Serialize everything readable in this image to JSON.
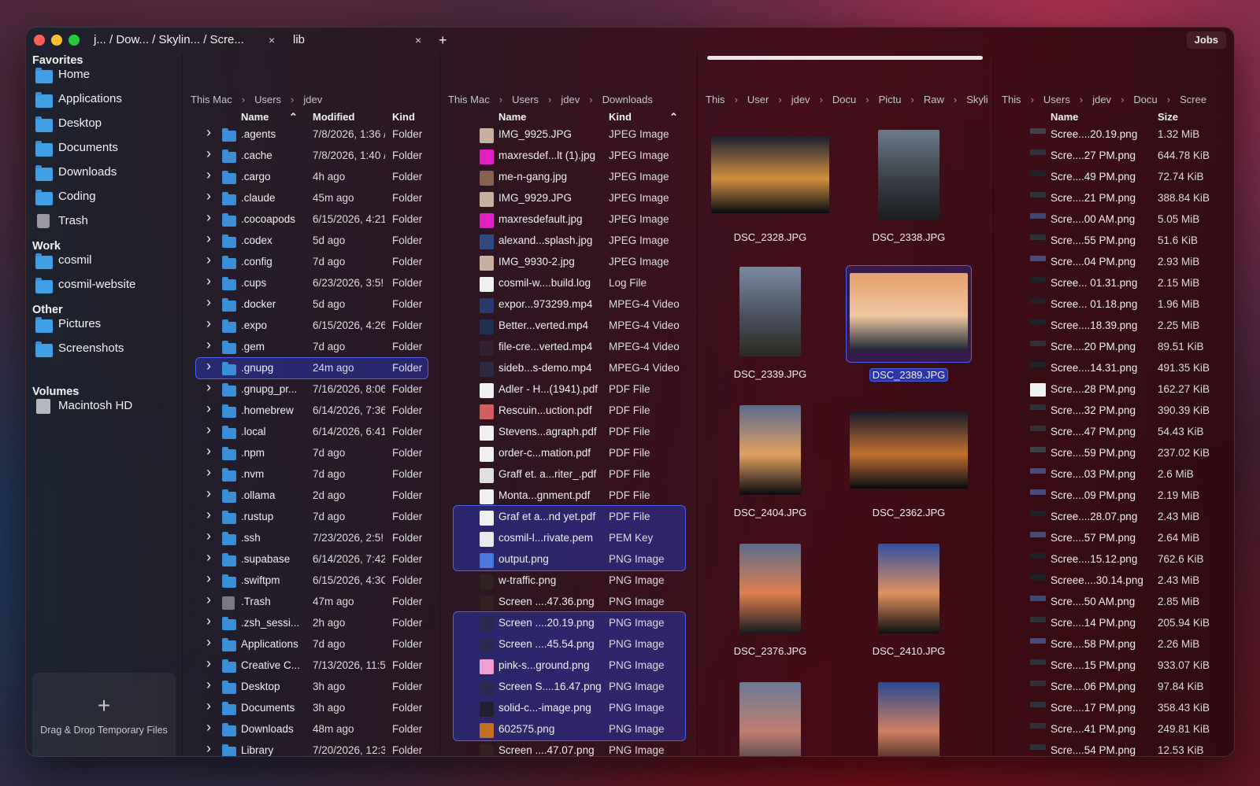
{
  "tabs": [
    {
      "label": "j... / Dow... / Skylin... / Scre...",
      "close": "×"
    },
    {
      "label": "lib",
      "close": "×"
    }
  ],
  "new_tab": "+",
  "jobs_label": "Jobs",
  "sidebar": {
    "sections": [
      {
        "title": "Favorites",
        "items": [
          "Home",
          "Applications",
          "Desktop",
          "Documents",
          "Downloads",
          "Coding",
          "Trash"
        ]
      },
      {
        "title": "Work",
        "items": [
          "cosmil",
          "cosmil-website"
        ]
      },
      {
        "title": "Other",
        "items": [
          "Pictures",
          "Screenshots"
        ]
      },
      {
        "title": "Volumes",
        "items": [
          "Macintosh HD"
        ]
      }
    ],
    "dropzone_plus": "+",
    "dropzone_label": "Drag & Drop Temporary Files"
  },
  "pane1": {
    "breadcrumb": [
      "This Mac",
      "Users",
      "jdev"
    ],
    "columns": [
      "Name",
      "Modified",
      "Kind"
    ],
    "rows": [
      [
        ".agents",
        "7/8/2026, 1:36 /",
        "Folder"
      ],
      [
        ".cache",
        "7/8/2026, 1:40 /",
        "Folder"
      ],
      [
        ".cargo",
        "4h ago",
        "Folder"
      ],
      [
        ".claude",
        "45m ago",
        "Folder"
      ],
      [
        ".cocoapods",
        "6/15/2026, 4:21",
        "Folder"
      ],
      [
        ".codex",
        "5d ago",
        "Folder"
      ],
      [
        ".config",
        "7d ago",
        "Folder"
      ],
      [
        ".cups",
        "6/23/2026, 3:5!",
        "Folder"
      ],
      [
        ".docker",
        "5d ago",
        "Folder"
      ],
      [
        ".expo",
        "6/15/2026, 4:26",
        "Folder"
      ],
      [
        ".gem",
        "7d ago",
        "Folder"
      ],
      [
        ".gnupg",
        "24m ago",
        "Folder"
      ],
      [
        ".gnupg_pr...",
        "7/16/2026, 8:06",
        "Folder"
      ],
      [
        ".homebrew",
        "6/14/2026, 7:36",
        "Folder"
      ],
      [
        ".local",
        "6/14/2026, 6:41",
        "Folder"
      ],
      [
        ".npm",
        "7d ago",
        "Folder"
      ],
      [
        ".nvm",
        "7d ago",
        "Folder"
      ],
      [
        ".ollama",
        "2d ago",
        "Folder"
      ],
      [
        ".rustup",
        "7d ago",
        "Folder"
      ],
      [
        ".ssh",
        "7/23/2026, 2:5!",
        "Folder"
      ],
      [
        ".supabase",
        "6/14/2026, 7:42",
        "Folder"
      ],
      [
        ".swiftpm",
        "6/15/2026, 4:3C",
        "Folder"
      ],
      [
        ".Trash",
        "47m ago",
        "Folder"
      ],
      [
        ".zsh_sessi...",
        "2h ago",
        "Folder"
      ],
      [
        "Applications",
        "7d ago",
        "Folder"
      ],
      [
        "Creative C...",
        "7/13/2026, 11:5€",
        "Folder"
      ],
      [
        "Desktop",
        "3h ago",
        "Folder"
      ],
      [
        "Documents",
        "3h ago",
        "Folder"
      ],
      [
        "Downloads",
        "48m ago",
        "Folder"
      ],
      [
        "Library",
        "7/20/2026, 12:3",
        "Folder"
      ]
    ]
  },
  "pane2": {
    "breadcrumb": [
      "This Mac",
      "Users",
      "jdev",
      "Downloads"
    ],
    "columns": [
      "Name",
      "Kind"
    ],
    "rows": [
      [
        "IMG_9925.JPG",
        "JPEG Image",
        "#c8b0a0"
      ],
      [
        "maxresdef...lt (1).jpg",
        "JPEG Image",
        "#e020c0"
      ],
      [
        "me-n-gang.jpg",
        "JPEG Image",
        "#8a6050"
      ],
      [
        "IMG_9929.JPG",
        "JPEG Image",
        "#c8b0a0"
      ],
      [
        "maxresdefault.jpg",
        "JPEG Image",
        "#e020c0"
      ],
      [
        "alexand...splash.jpg",
        "JPEG Image",
        "#304a80"
      ],
      [
        "IMG_9930-2.jpg",
        "JPEG Image",
        "#c8b0a0"
      ],
      [
        "cosmil-w....build.log",
        "Log File",
        "#f0f0f0"
      ],
      [
        "expor...973299.mp4",
        "MPEG-4 Video",
        "#2a3a70"
      ],
      [
        "Better...verted.mp4",
        "MPEG-4 Video",
        "#203050"
      ],
      [
        "file-cre...verted.mp4",
        "MPEG-4 Video",
        "#302030"
      ],
      [
        "sideb...s-demo.mp4",
        "MPEG-4 Video",
        "#302840"
      ],
      [
        "Adler - H...(1941).pdf",
        "PDF File",
        "#f0f0f0"
      ],
      [
        "Rescuin...uction.pdf",
        "PDF File",
        "#d06060"
      ],
      [
        "Stevens...agraph.pdf",
        "PDF File",
        "#f0f0f0"
      ],
      [
        "order-c...mation.pdf",
        "PDF File",
        "#f0f0f0"
      ],
      [
        "Graff et. a...riter_.pdf",
        "PDF File",
        "#e0e0e0"
      ],
      [
        "Monta...gnment.pdf",
        "PDF File",
        "#f0f0f0"
      ],
      [
        "Graf et a...nd yet.pdf",
        "PDF File",
        "#f0f0f0"
      ],
      [
        "cosmil-l...rivate.pem",
        "PEM Key",
        "#e8e8ee"
      ],
      [
        "output.png",
        "PNG Image",
        "#4a7ae0"
      ],
      [
        "w-traffic.png",
        "PNG Image",
        "#302020"
      ],
      [
        "Screen ....47.36.png",
        "PNG Image",
        "#302020"
      ],
      [
        "Screen ....20.19.png",
        "PNG Image",
        "#2a2a50"
      ],
      [
        "Screen ....45.54.png",
        "PNG Image",
        "#2a2a50"
      ],
      [
        "pink-s...ground.png",
        "PNG Image",
        "#f0a0d0"
      ],
      [
        "Screen S....16.47.png",
        "PNG Image",
        "#2a2a50"
      ],
      [
        "solid-c...-image.png",
        "PNG Image",
        "#202030"
      ],
      [
        "602575.png",
        "PNG Image",
        "#c07020"
      ],
      [
        "Screen ....47.07.png",
        "PNG Image",
        "#302020"
      ]
    ]
  },
  "pane3": {
    "breadcrumb": [
      "This",
      "User",
      "jdev",
      "Docu",
      "Pictu",
      "Raw",
      "Skyli"
    ],
    "thumbnails": [
      {
        "label": "DSC_2328.JPG",
        "orientation": "landscape",
        "colors": [
          "#1a1f2e",
          "#d09040",
          "#0a0a10"
        ]
      },
      {
        "label": "DSC_2338.JPG",
        "orientation": "portrait",
        "colors": [
          "#6a7a8a",
          "#3a4048",
          "#1a1c20"
        ]
      },
      {
        "label": "DSC_2339.JPG",
        "orientation": "portrait",
        "colors": [
          "#7a8aa0",
          "#4a5060",
          "#2a2a20"
        ]
      },
      {
        "label": "DSC_2389.JPG",
        "orientation": "landscape",
        "colors": [
          "#e8a070",
          "#f0c8a0",
          "#202838"
        ]
      },
      {
        "label": "DSC_2404.JPG",
        "orientation": "portrait",
        "colors": [
          "#5a6a90",
          "#e0a060",
          "#0a0a10"
        ]
      },
      {
        "label": "DSC_2362.JPG",
        "orientation": "landscape",
        "colors": [
          "#1a1a2a",
          "#c07030",
          "#0a0a10"
        ]
      },
      {
        "label": "DSC_2376.JPG",
        "orientation": "portrait",
        "colors": [
          "#5a6a8a",
          "#e08050",
          "#1a1a20"
        ]
      },
      {
        "label": "DSC_2410.JPG",
        "orientation": "portrait",
        "colors": [
          "#3050a0",
          "#e09060",
          "#101010"
        ]
      },
      {
        "label": "",
        "orientation": "portrait",
        "colors": [
          "#6a7a98",
          "#c08070",
          "#303040"
        ]
      },
      {
        "label": "",
        "orientation": "portrait",
        "colors": [
          "#2a4a90",
          "#d08060",
          "#101010"
        ]
      }
    ]
  },
  "pane4": {
    "breadcrumb": [
      "This",
      "Users",
      "jdev",
      "Docu",
      "Scree"
    ],
    "columns": [
      "Name",
      "Size"
    ],
    "rows": [
      [
        "Scree....20.19.png",
        "1.32 MiB",
        "#404050"
      ],
      [
        "Scre....27 PM.png",
        "644.78 KiB",
        "#303040"
      ],
      [
        "Scre....49 PM.png",
        "72.74 KiB",
        "#202028"
      ],
      [
        "Scre....21 PM.png",
        "388.84 KiB",
        "#303038"
      ],
      [
        "Scre....00 AM.png",
        "5.05 MiB",
        "#3a4a70"
      ],
      [
        "Scre....55 PM.png",
        "51.6 KiB",
        "#303038"
      ],
      [
        "Scre....04 PM.png",
        "2.93 MiB",
        "#4a4a80"
      ],
      [
        "Scree... 01.31.png",
        "2.15 MiB",
        "#202028"
      ],
      [
        "Scree... 01.18.png",
        "1.96 MiB",
        "#202028"
      ],
      [
        "Scree....18.39.png",
        "2.25 MiB",
        "#202028"
      ],
      [
        "Scre....20 PM.png",
        "89.51 KiB",
        "#303038"
      ],
      [
        "Scree....14.31.png",
        "491.35 KiB",
        "#202028"
      ],
      [
        "Scre....28 PM.png",
        "162.27 KiB",
        "#f0f0f0"
      ],
      [
        "Scre....32 PM.png",
        "390.39 KiB",
        "#303038"
      ],
      [
        "Scre....47 PM.png",
        "54.43 KiB",
        "#303038"
      ],
      [
        "Scre....59 PM.png",
        "237.02 KiB",
        "#404048"
      ],
      [
        "Scre....03 PM.png",
        "2.6 MiB",
        "#4a4a80"
      ],
      [
        "Scre....09 PM.png",
        "2.19 MiB",
        "#4a4a80"
      ],
      [
        "Scree....28.07.png",
        "2.43 MiB",
        "#202028"
      ],
      [
        "Scre....57 PM.png",
        "2.64 MiB",
        "#4a4a70"
      ],
      [
        "Scree....15.12.png",
        "762.6 KiB",
        "#202028"
      ],
      [
        "Screee....30.14.png",
        "2.43 MiB",
        "#202028"
      ],
      [
        "Scre....50 AM.png",
        "2.85 MiB",
        "#3a4a70"
      ],
      [
        "Scre....14 PM.png",
        "205.94 KiB",
        "#303038"
      ],
      [
        "Scre....58 PM.png",
        "2.26 MiB",
        "#4a4a80"
      ],
      [
        "Scre....15 PM.png",
        "933.07 KiB",
        "#303038"
      ],
      [
        "Scre....06 PM.png",
        "97.84 KiB",
        "#303038"
      ],
      [
        "Scre....17 PM.png",
        "358.43 KiB",
        "#303038"
      ],
      [
        "Scre....41 PM.png",
        "249.81 KiB",
        "#303038"
      ],
      [
        "Scre....54 PM.png",
        "12.53 KiB",
        "#303038"
      ]
    ]
  },
  "selection": {
    "pane1_selected": ".gnupg",
    "pane2_selected": [
      "Graf et a...nd yet.pdf",
      "cosmil-l...rivate.pem",
      "output.png",
      "Screen ....20.19.png",
      "Screen ....45.54.png",
      "pink-s...ground.png",
      "Screen S....16.47.png",
      "solid-c...-image.png",
      "602575.png"
    ],
    "pane3_selected": "DSC_2389.JPG"
  },
  "colors": {
    "accent": "#4a64e8",
    "folder": "#3a8fd6",
    "selection_fill": "#2c34aa"
  }
}
